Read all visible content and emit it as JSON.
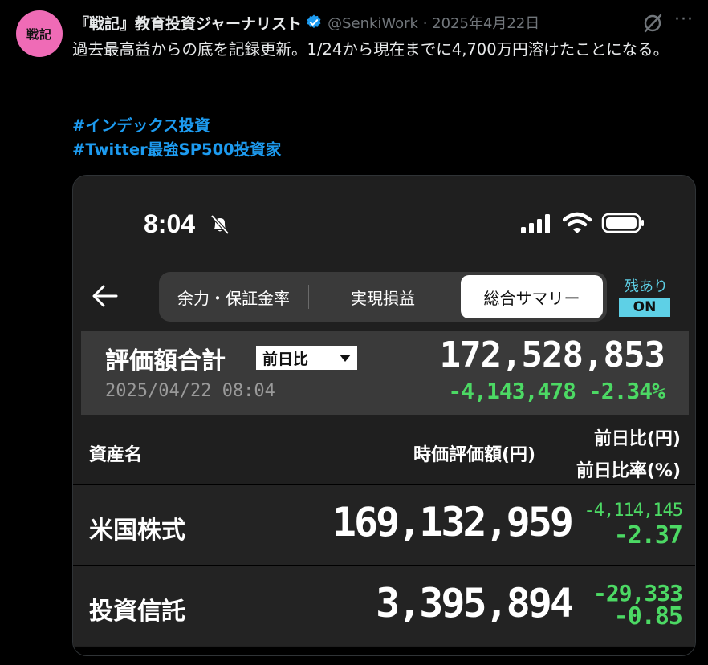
{
  "tweet": {
    "avatar_text": "戦記",
    "author_name": "『戦記』教育投資ジャーナリスト",
    "meta": "@SenkiWork · 2025年4月22日",
    "more_label": "···",
    "text": "過去最高益からの底を記録更新。1/24から現在までに4,700万円溶けたことになる。",
    "hashtags": [
      "#インデックス投資",
      "#Twitter最強SP500投資家"
    ]
  },
  "app": {
    "status_time": "8:04",
    "tabs": [
      "余力・保証金率",
      "実現損益",
      "総合サマリー"
    ],
    "active_tab": "総合サマリー",
    "remaining_label": "残あり",
    "toggle_label": "ON",
    "total": {
      "label": "評価額合計",
      "compare_select": "前日比",
      "date": "2025/04/22 08:04",
      "value": "172,528,853",
      "change": "-4,143,478 -2.34%"
    },
    "table": {
      "col_name": "資産名",
      "col_value": "時価評価額(円)",
      "col_change": "前日比(円)",
      "col_change_pct": "前日比率(%)",
      "rows": [
        {
          "name": "米国株式",
          "value": "169,132,959",
          "change": "-4,114,145",
          "change_pct": "-2.37"
        },
        {
          "name": "投資信託",
          "value": "3,395,894",
          "change": "-29,333",
          "change_pct": "-0.85"
        }
      ]
    }
  },
  "colors": {
    "accent_link": "#1d9bf0",
    "negative_change": "#4cd964",
    "toggle_on": "#5ed0e6",
    "avatar": "#ef6bb6"
  }
}
